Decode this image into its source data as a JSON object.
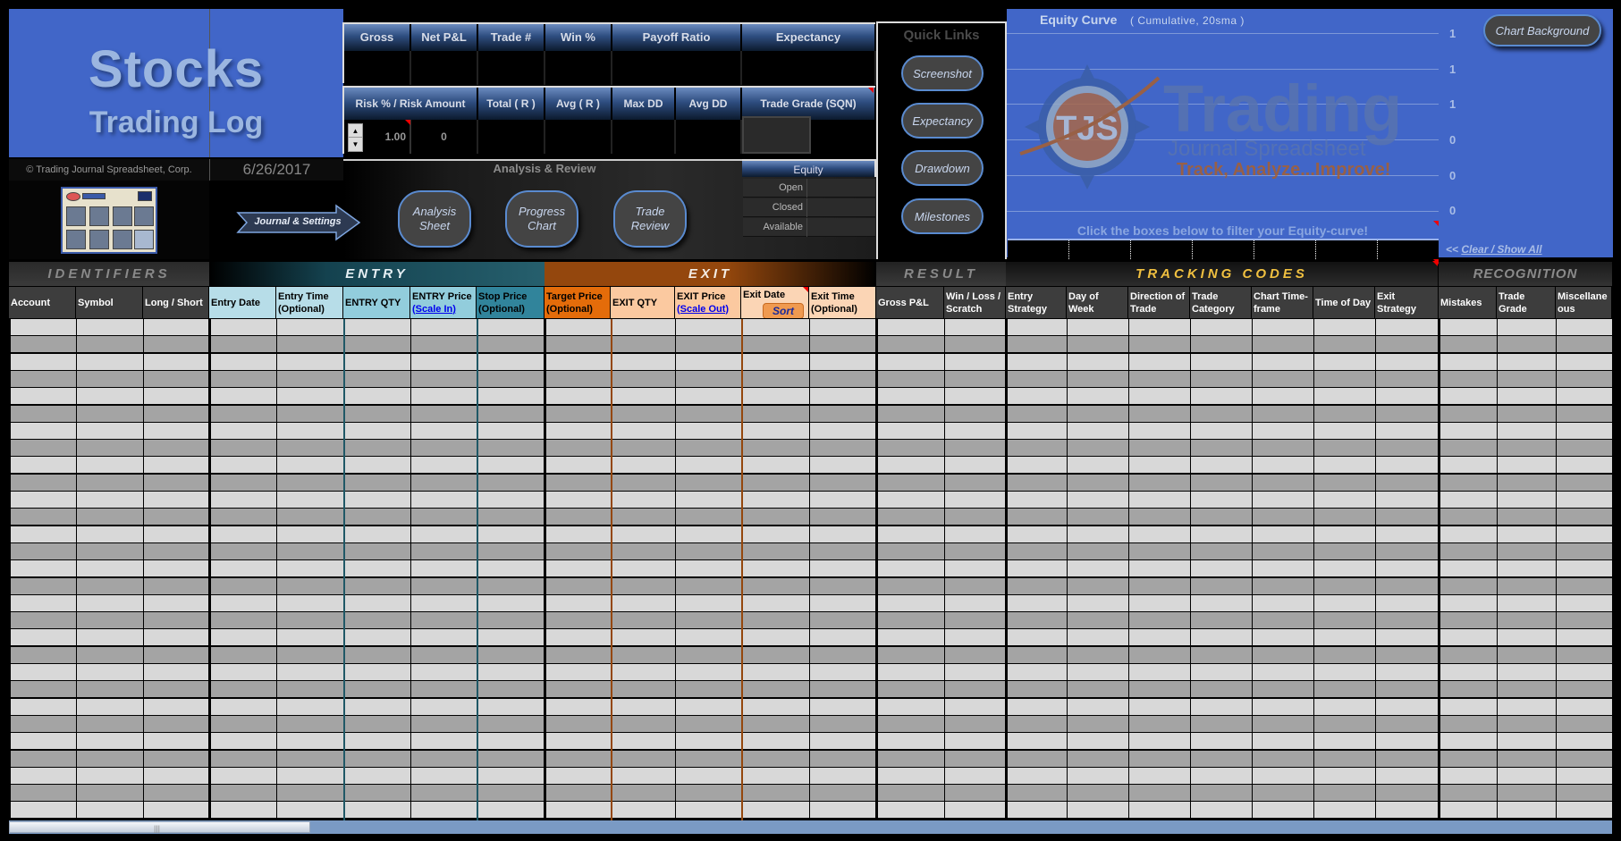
{
  "title": {
    "main": "Stocks",
    "sub": "Trading Log",
    "copyright": "© Trading Journal Spreadsheet, Corp.",
    "date": "6/26/2017"
  },
  "stats_row1": {
    "headers": [
      "Gross",
      "Net P&L",
      "Trade #",
      "Win %",
      "Payoff Ratio",
      "Expectancy"
    ],
    "values": [
      "",
      "",
      "",
      "",
      "",
      ""
    ]
  },
  "stats_row2": {
    "headers": [
      "Risk %  /  Risk Amount",
      "Total ( R )",
      "Avg ( R )",
      "Max DD",
      "Avg DD",
      "Trade Grade (SQN)"
    ],
    "risk_percent": "1.00",
    "risk_amount": "0",
    "values": [
      "",
      "",
      "",
      "",
      ""
    ]
  },
  "analysis": {
    "title": "Analysis & Review",
    "journal_button": "Journal & Settings",
    "buttons": [
      {
        "line1": "Analysis",
        "line2": "Sheet"
      },
      {
        "line1": "Progress",
        "line2": "Chart"
      },
      {
        "line1": "Trade",
        "line2": "Review"
      }
    ]
  },
  "equity_table": {
    "title": "Equity",
    "rows": [
      {
        "label": "Open",
        "value": ""
      },
      {
        "label": "Closed",
        "value": ""
      },
      {
        "label": "Available",
        "value": ""
      }
    ]
  },
  "quick_links": {
    "title": "Quick Links",
    "buttons": [
      "Screenshot",
      "Expectancy",
      "Drawdown",
      "Milestones"
    ]
  },
  "equity_chart": {
    "title": "Equity Curve",
    "subtitle": "( Cumulative,   20sma )",
    "y_ticks": [
      "1",
      "1",
      "1",
      "0",
      "0",
      "0"
    ],
    "hint": "Click the boxes below to filter your Equity-curve!",
    "background_button": "Chart Background",
    "clear_prefix": "<<",
    "clear_link": "Clear / Show All",
    "filter_box_count": 7,
    "watermark": {
      "brand": "Trading",
      "line2": "Journal Spreadsheet",
      "tagline": "Track, Analyze...Improve!",
      "badge": "TJS"
    }
  },
  "groups": [
    {
      "label": "IDENTIFIERS"
    },
    {
      "label": "ENTRY"
    },
    {
      "label": "EXIT"
    },
    {
      "label": "RESULT"
    },
    {
      "label": "TRACKING CODES"
    },
    {
      "label": "RECOGNITION"
    }
  ],
  "columns": [
    {
      "l1": "Account",
      "l2": ""
    },
    {
      "l1": "Symbol",
      "l2": ""
    },
    {
      "l1": "Long / Short",
      "l2": ""
    },
    {
      "l1": "Entry Date",
      "l2": ""
    },
    {
      "l1": "Entry Time",
      "l2": "(Optional)"
    },
    {
      "l1": "ENTRY QTY",
      "l2": ""
    },
    {
      "l1": "ENTRY Price",
      "l2": "(Scale In)"
    },
    {
      "l1": "Stop Price",
      "l2": "(Optional)"
    },
    {
      "l1": "Target Price",
      "l2": "(Optional)"
    },
    {
      "l1": "EXIT QTY",
      "l2": ""
    },
    {
      "l1": "EXIT Price",
      "l2": "(Scale Out)"
    },
    {
      "l1": "Exit Date",
      "l2": "Sort"
    },
    {
      "l1": "Exit Time",
      "l2": "(Optional)"
    },
    {
      "l1": "Gross P&L",
      "l2": ""
    },
    {
      "l1": "Win / Loss /",
      "l2": "Scratch"
    },
    {
      "l1": "Entry",
      "l2": "Strategy"
    },
    {
      "l1": "Day of",
      "l2": "Week"
    },
    {
      "l1": "Direction of",
      "l2": "Trade"
    },
    {
      "l1": "Trade",
      "l2": "Category"
    },
    {
      "l1": "Chart Time-",
      "l2": "frame"
    },
    {
      "l1": "Time of Day",
      "l2": ""
    },
    {
      "l1": "Exit",
      "l2": "Strategy"
    },
    {
      "l1": "Mistakes",
      "l2": ""
    },
    {
      "l1": "Trade",
      "l2": "Grade"
    },
    {
      "l1": "Miscellane",
      "l2": "ous"
    }
  ],
  "row_count": 29,
  "colors": {
    "title_blue": "#4166c8",
    "entry_light": "#b7dde8",
    "entry_mid": "#92cddc",
    "entry_dark": "#31849b",
    "exit_orange": "#e46c0a",
    "exit_light": "#fbc9a0",
    "tracking_gold": "#f0c040",
    "row_light": "#d8d8d8",
    "row_dark": "#a4a4a4"
  }
}
